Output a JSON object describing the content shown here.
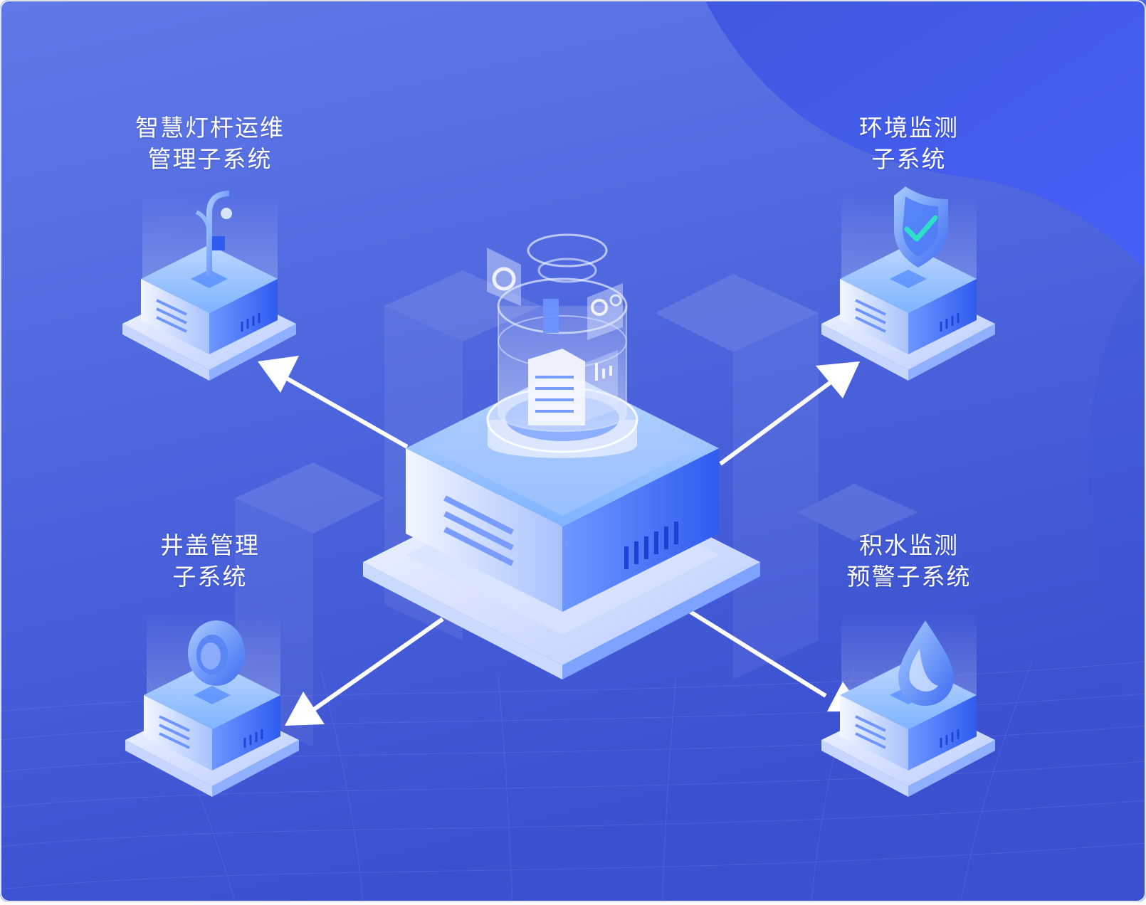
{
  "diagram": {
    "colors": {
      "background_top": "#5b74e6",
      "background_bottom": "#3d54d4",
      "accent_wave": "#4a5ef0",
      "arrow": "#ffffff",
      "node_top": "#63b6ff",
      "node_face_light": "#dbe8ff",
      "node_face_blue": "#3f73f5",
      "check": "#2ee0c8"
    },
    "center": {
      "icon": "database-server-icon"
    },
    "nodes": [
      {
        "id": "streetlight",
        "icon": "lamp-post-icon",
        "line1": "智慧灯杆运维",
        "line2": "管理子系统"
      },
      {
        "id": "environment",
        "icon": "shield-check-icon",
        "line1": "环境监测",
        "line2": "子系统"
      },
      {
        "id": "manhole",
        "icon": "manhole-cover-icon",
        "line1": "井盖管理",
        "line2": "子系统"
      },
      {
        "id": "waterlogging",
        "icon": "water-drop-icon",
        "line1": "积水监测",
        "line2": "预警子系统"
      }
    ]
  }
}
